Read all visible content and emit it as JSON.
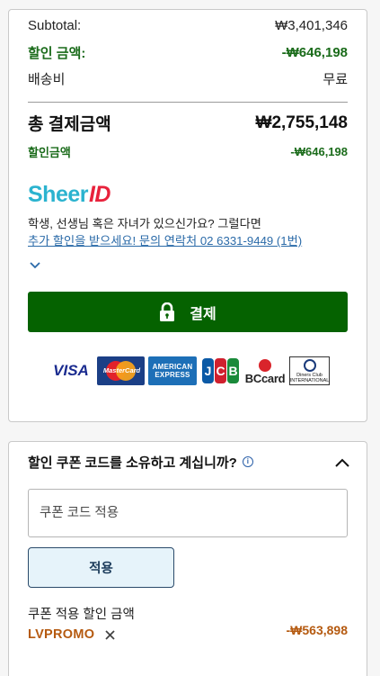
{
  "summary": {
    "subtotal_label": "Subtotal:",
    "subtotal_value": "₩3,401,346",
    "discount_label": "할인 금액:",
    "discount_value": "-₩646,198",
    "shipping_label": "배송비",
    "shipping_value": "무료",
    "total_label": "총 결제금액",
    "total_value": "₩2,755,148",
    "savings_label": "할인금액",
    "savings_value": "-₩646,198"
  },
  "sheerid": {
    "logo_text": "Sheer",
    "logo_mark": "ID",
    "message_line1": "학생, 선생님 혹은 자녀가 있으신가요? 그럴다면",
    "message_link": "추가 할인을 받으세요! 문의 연락처 02 6331-9449 (1번)",
    "expand_icon": "chevron-down-icon"
  },
  "checkout": {
    "pay_label": "결제",
    "pay_icon": "lock-icon"
  },
  "payment_logos": {
    "visa": "VISA",
    "mastercard": "MasterCard",
    "amex_line1": "AMERICAN",
    "amex_line2": "EXPRESS",
    "jcb": [
      "J",
      "C",
      "B"
    ],
    "bccard": "BCcard",
    "diners_line1": "Diners Club",
    "diners_line2": "INTERNATIONAL"
  },
  "coupon": {
    "title": "할인 쿠폰 코드를 소유하고 계십니까?",
    "info_icon": "info-icon",
    "toggle_icon": "chevron-up-icon",
    "input_placeholder": "쿠폰 코드 적용",
    "input_value": "",
    "apply_label": "적용",
    "applied_label": "쿠폰 적용 할인 금액",
    "applied_code": "LVPROMO",
    "applied_amount": "-₩563,898"
  },
  "colors": {
    "discount_green": "#1a6b1a",
    "pay_button": "#056200",
    "coupon_orange": "#b55a10",
    "link_blue": "#2a6aa8",
    "apply_bg": "#e6f3fa"
  }
}
